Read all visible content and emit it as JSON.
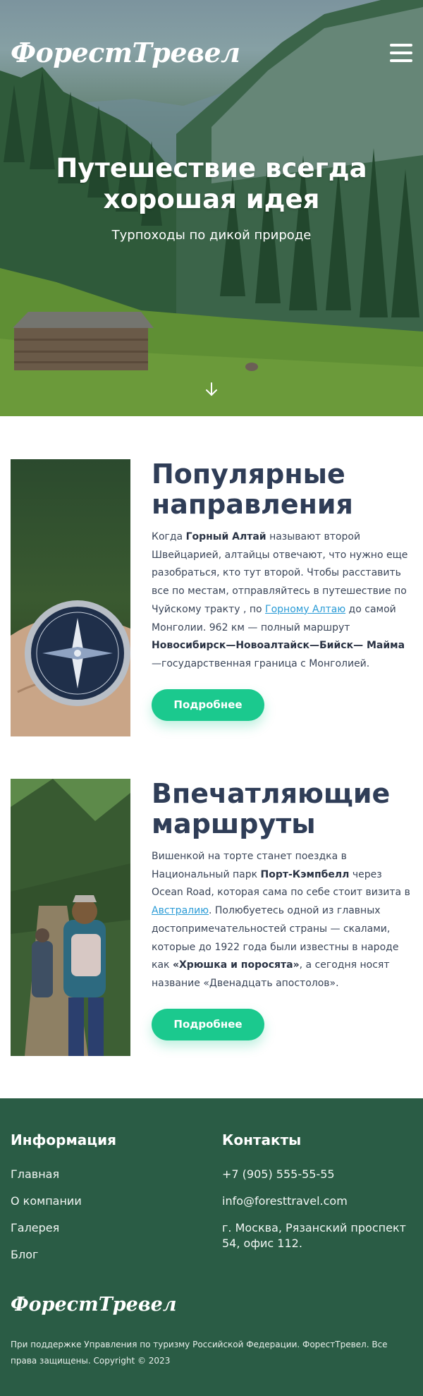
{
  "brand": "ФорестТревел",
  "hero": {
    "title": "Путешествие всегда хорошая идея",
    "subtitle": "Турпоходы по дикой природе"
  },
  "sections": [
    {
      "title": "Популярные направления",
      "button": "Подробнее",
      "text": {
        "t1": "Когда ",
        "b1": "Горный Алтай",
        "t2": " называют второй Швейцарией, алтайцы отвечают, что нужно еще разобраться, кто тут второй. Чтобы расставить все по местам, отправляйтесь в путешествие по Чуйскому тракту , по ",
        "link": "Горному Алтаю",
        "t3": " до самой Монголии. 962 км — полный маршрут ",
        "b2": "Новосибирск—Новоалтайск—Бийск— Майма",
        "t4": " —государственная граница с Монголией."
      }
    },
    {
      "title": "Впечатляющие маршруты",
      "button": "Подробнее",
      "text": {
        "t1": "Вишенкой на торте станет поездка в Национальный парк ",
        "b1": "Порт-Кэмпбелл",
        "t2": " через Ocean Road, которая сама по себе стоит визита в ",
        "link": "Австралию",
        "t3": ". Полюбуетесь одной из главных достопримечательностей страны — скалами, которые до 1922 года были известны в народе как ",
        "b2": "«Хрюшка и поросята»",
        "t4": ", а сегодня носят название «Двенадцать апостолов»."
      }
    }
  ],
  "footer": {
    "info_title": "Информация",
    "info_links": [
      "Главная",
      "О компании",
      "Галерея",
      "Блог"
    ],
    "contacts_title": "Контакты",
    "phone": "+7 (905) 555-55-55",
    "email": "info@foresttravel.com",
    "address": "г. Москва, Рязанский проспект 54, офис 112.",
    "logo": "ФорестТревел",
    "copyright": "При поддержке Управления по туризму Российской Федерации. ФорестТревел. Все права защищены. Copyright © 2023"
  },
  "colors": {
    "accent": "#1bc98e",
    "footer_bg": "#2a5c45",
    "heading": "#2f3d57",
    "link": "#2a9bd6"
  },
  "icons": {
    "menu": "hamburger-menu-icon",
    "scroll": "arrow-down-icon"
  }
}
